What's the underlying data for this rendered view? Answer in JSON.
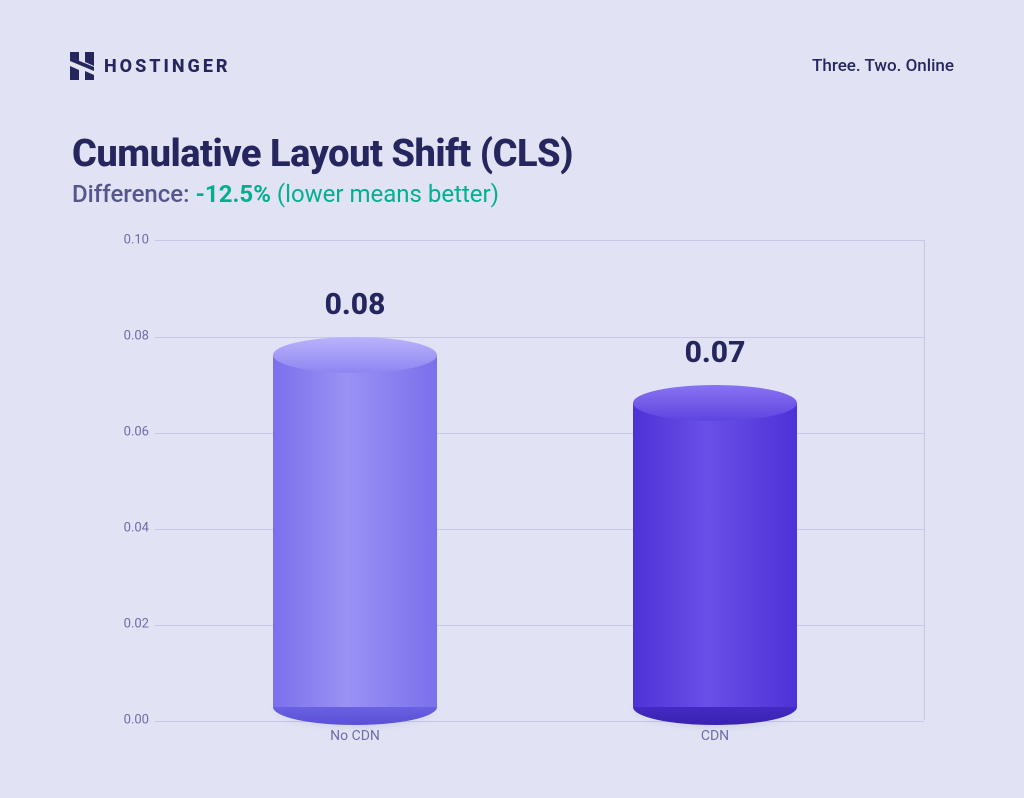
{
  "header": {
    "brand_name": "HOSTINGER",
    "tagline": "Three. Two. Online"
  },
  "title": "Cumulative Layout Shift (CLS)",
  "subtitle_prefix": "Difference: ",
  "difference_value": "-12.5%",
  "difference_note": " (lower means better)",
  "chart_data": {
    "type": "bar",
    "categories": [
      "No CDN",
      "CDN"
    ],
    "values": [
      0.08,
      0.07
    ],
    "value_labels": [
      "0.08",
      "0.07"
    ],
    "ytick_labels": [
      "0.00",
      "0.02",
      "0.04",
      "0.06",
      "0.08",
      "0.10"
    ],
    "ylim": [
      0,
      0.1
    ],
    "title": "Cumulative Layout Shift (CLS)",
    "xlabel": "",
    "ylabel": "",
    "colors": {
      "no_cdn": "#8C84F0",
      "cdn": "#5338DB"
    }
  }
}
